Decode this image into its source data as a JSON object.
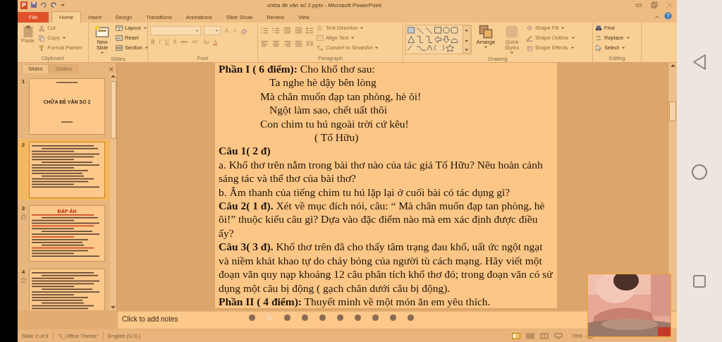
{
  "window": {
    "app_icon": "P",
    "title": "chữa đề văn số 2.pptx - Microsoft PowerPoint"
  },
  "tabs": [
    {
      "label": "File",
      "kind": "file",
      "selected": false
    },
    {
      "label": "Home",
      "kind": "tab",
      "selected": true
    },
    {
      "label": "Insert",
      "kind": "tab",
      "selected": false
    },
    {
      "label": "Design",
      "kind": "tab",
      "selected": false
    },
    {
      "label": "Transitions",
      "kind": "tab",
      "selected": false
    },
    {
      "label": "Animations",
      "kind": "tab",
      "selected": false
    },
    {
      "label": "Slide Show",
      "kind": "tab",
      "selected": false
    },
    {
      "label": "Review",
      "kind": "tab",
      "selected": false
    },
    {
      "label": "View",
      "kind": "tab",
      "selected": false
    }
  ],
  "ribbon": {
    "clipboard": {
      "label": "Clipboard",
      "large": [
        {
          "label": "Paste",
          "disabled": true,
          "menu": false
        }
      ],
      "small": [
        {
          "label": "Cut",
          "disabled": true,
          "menu": false
        },
        {
          "label": "Copy",
          "disabled": true,
          "menu": true
        },
        {
          "label": "Format Painter",
          "disabled": true,
          "menu": false
        }
      ]
    },
    "slides": {
      "label": "Slides",
      "large": [
        {
          "label": "New Slide",
          "disabled": false,
          "menu": true
        }
      ],
      "small": [
        {
          "label": "Layout",
          "disabled": false,
          "menu": true
        },
        {
          "label": "Reset",
          "disabled": false,
          "menu": false
        },
        {
          "label": "Section",
          "disabled": false,
          "menu": true
        }
      ]
    },
    "font": {
      "label": "Font",
      "size_buttons": [
        {
          "label": "A",
          "kind": "grow"
        },
        {
          "label": "A",
          "kind": "shrink"
        }
      ],
      "format_buttons": [
        {
          "label": "B",
          "kind": "bold"
        },
        {
          "label": "I",
          "kind": "italic"
        },
        {
          "label": "U",
          "kind": "underline"
        },
        {
          "label": "S",
          "kind": "shadow"
        },
        {
          "label": "abc",
          "kind": "strike"
        },
        {
          "label": "AV",
          "kind": "spacing"
        },
        {
          "label": "Aa",
          "kind": "case"
        },
        {
          "label": "A",
          "kind": "color"
        }
      ]
    },
    "paragraph": {
      "label": "Paragraph",
      "small": [
        {
          "label": "Text Direction",
          "disabled": true,
          "menu": true
        },
        {
          "label": "Align Text",
          "disabled": true,
          "menu": true
        },
        {
          "label": "Convert to SmartArt",
          "disabled": true,
          "menu": true
        }
      ]
    },
    "drawing": {
      "label": "Drawing",
      "large": [
        {
          "label": "Arrange",
          "disabled": false,
          "menu": true
        },
        {
          "label": "Quick Styles",
          "disabled": true,
          "menu": true
        }
      ],
      "small": [
        {
          "label": "Shape Fill",
          "disabled": true,
          "menu": true
        },
        {
          "label": "Shape Outline",
          "disabled": true,
          "menu": true
        },
        {
          "label": "Shape Effects",
          "disabled": true,
          "menu": true
        }
      ]
    },
    "editing": {
      "label": "Editing",
      "small": [
        {
          "label": "Find",
          "disabled": false,
          "menu": false
        },
        {
          "label": "Replace",
          "disabled": false,
          "menu": true
        },
        {
          "label": "Select",
          "disabled": false,
          "menu": true
        }
      ]
    }
  },
  "side_panel": {
    "tabs": [
      {
        "label": "Slides",
        "selected": true
      },
      {
        "label": "Outline",
        "selected": false
      }
    ],
    "close": "×",
    "thumbnails": [
      {
        "number": "1",
        "selected": false,
        "animated": false,
        "kind": "title-slide",
        "title": "CHỮA ĐỀ VĂN SỐ 2"
      },
      {
        "number": "2",
        "selected": true,
        "animated": false,
        "kind": "text"
      },
      {
        "number": "3",
        "selected": false,
        "animated": true,
        "kind": "heading",
        "title": "ĐÁP ÁN"
      },
      {
        "number": "4",
        "selected": false,
        "animated": true,
        "kind": "text"
      }
    ]
  },
  "slide": {
    "paragraphs": [
      {
        "kind": "para",
        "text": "**Phần I ( 6 điểm):** Cho khổ thơ sau:"
      },
      {
        "kind": "verse-b",
        "text": "Ta nghe hè dậy bên lòng"
      },
      {
        "kind": "verse-a",
        "text": "Mà chân muốn đạp tan phòng, hè ôi!"
      },
      {
        "kind": "verse-b",
        "text": "Ngột làm sao, chết uất thôi"
      },
      {
        "kind": "verse-a",
        "text": "Con chim tu hú ngoài trời cứ kêu!"
      },
      {
        "kind": "credit",
        "text": "( Tố Hữu)"
      },
      {
        "kind": "heading",
        "text": "Câu 1( 2 đ)"
      },
      {
        "kind": "para",
        "text": "a. Khổ thơ trên nằm trong bài thơ nào của tác giả Tố Hữu? Nêu hoàn cảnh sáng tác và thể thơ của bài thơ?"
      },
      {
        "kind": "para",
        "text": "b. Âm thanh của tiếng chim tu hú lặp lại ở cuối bài có tác dụng gì?"
      },
      {
        "kind": "para",
        "text": "**Câu 2( 1 đ).** Xét về mục đích nói, câu: “ Mà chân muốn đạp tan phòng, hè ôi!” thuộc kiểu câu gì? Dựa vào đặc điểm nào mà em xác định được điều ấy?"
      },
      {
        "kind": "para",
        "text": "**Câu 3( 3 đ).** Khổ thơ trên đã cho thấy tâm trạng đau khổ, uất ức ngột ngạt và niềm khát khao tự do cháy bỏng của người tù cách mạng. Hãy viết một đoạn văn quy nạp khoảng 12 câu phân tích khổ thơ đó; trong đoạn văn có sử dụng một câu bị động ( gạch chân dưới câu bị động)."
      },
      {
        "kind": "para",
        "text": "**Phần II ( 4 điểm):** Thuyết minh về một món ăn em yêu thích."
      }
    ]
  },
  "notes": {
    "placeholder": "Click to add notes"
  },
  "page_dots": [
    {
      "selected": false
    },
    {
      "selected": true
    },
    {
      "selected": false
    },
    {
      "selected": false
    },
    {
      "selected": false
    },
    {
      "selected": false
    },
    {
      "selected": false
    },
    {
      "selected": false
    },
    {
      "selected": false
    },
    {
      "selected": false
    }
  ],
  "status_bar": {
    "slide": "Slide 2 of 9",
    "theme": "\"1_Office Theme\"",
    "language": "English (U.S.)",
    "zoom": "76%"
  }
}
